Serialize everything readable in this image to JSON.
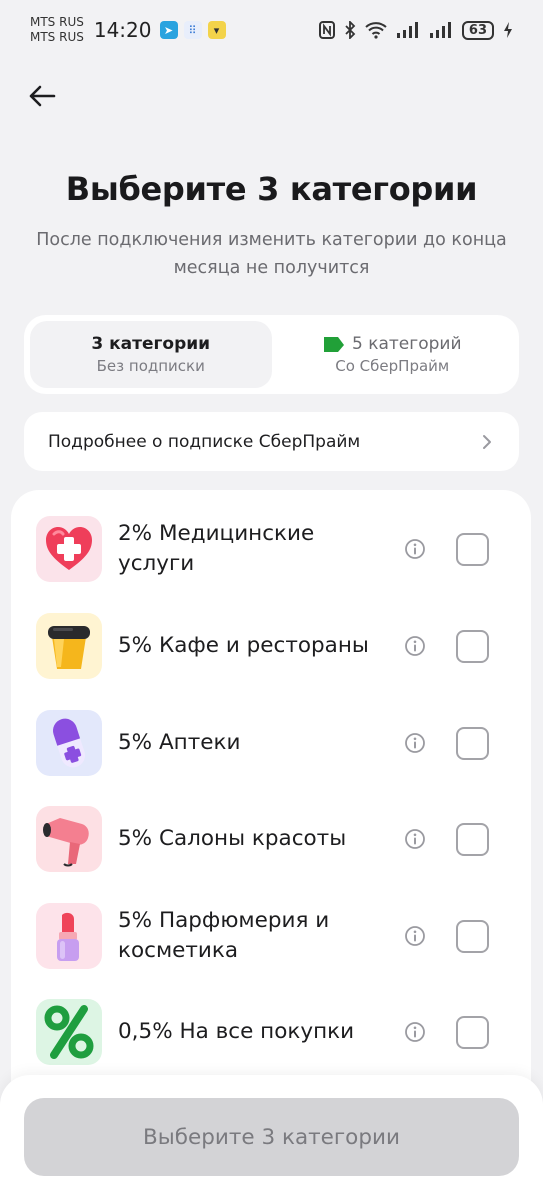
{
  "status_bar": {
    "carrier_1": "MTS RUS",
    "carrier_2": "MTS RUS",
    "time": "14:20",
    "battery": "63"
  },
  "header": {
    "title": "Выберите 3 категории",
    "subtitle": "После подключения изменить категории до конца месяца не получится"
  },
  "plans": [
    {
      "name": "3 категории",
      "subtitle": "Без подписки",
      "selected": true
    },
    {
      "name": "5 категорий",
      "subtitle": "Со СберПрайм",
      "selected": false
    }
  ],
  "info_row": {
    "label": "Подробнее о подписке СберПрайм"
  },
  "categories": [
    {
      "label": "2% Медицинские услуги",
      "icon": "medical-heart-icon",
      "checked": false
    },
    {
      "label": "5% Кафе и рестораны",
      "icon": "coffee-cup-icon",
      "checked": false
    },
    {
      "label": "5% Аптеки",
      "icon": "pill-capsule-icon",
      "checked": false
    },
    {
      "label": "5% Салоны красоты",
      "icon": "hair-dryer-icon",
      "checked": false
    },
    {
      "label": "5% Парфюмерия и косметика",
      "icon": "lipstick-icon",
      "checked": false
    },
    {
      "label": "0,5% На все покупки",
      "icon": "percent-icon",
      "checked": false
    }
  ],
  "submit": {
    "label": "Выберите 3 категории",
    "enabled": false
  },
  "colors": {
    "background": "#f2f2f4",
    "card": "#ffffff",
    "sber_green": "#21a038",
    "disabled_button": "#d3d3d6"
  }
}
